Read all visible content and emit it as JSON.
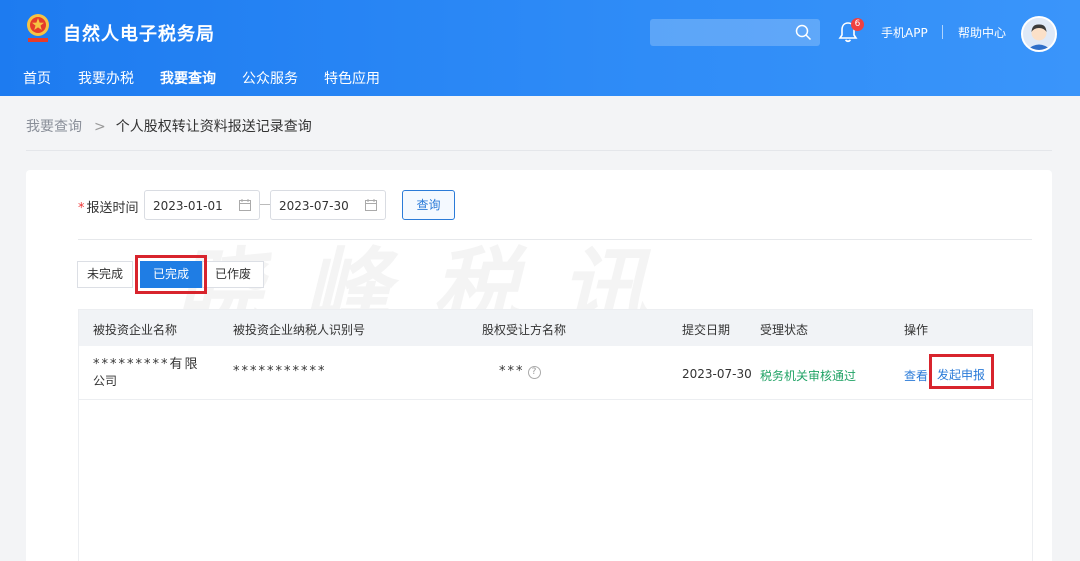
{
  "header": {
    "site_title": "自然人电子税务局",
    "logo_icon": "tax-emblem-icon",
    "bell_badge": "6",
    "links": {
      "app": "手机APP",
      "help": "帮助中心"
    }
  },
  "nav": {
    "items": [
      "首页",
      "我要办税",
      "我要查询",
      "公众服务",
      "特色应用"
    ],
    "active": "我要查询"
  },
  "breadcrumb": {
    "parent": "我要查询",
    "separator": ">",
    "current": "个人股权转让资料报送记录查询"
  },
  "watermark": "晓峰税讯",
  "form": {
    "label": "报送时间",
    "required_mark": "*",
    "start_date": "2023-01-01",
    "end_date": "2023-07-30",
    "query_button": "查询"
  },
  "tabs": [
    "未完成",
    "已完成",
    "已作废"
  ],
  "active_tab": "已完成",
  "table": {
    "headers": [
      "被投资企业名称",
      "被投资企业纳税人识别号",
      "股权受让方名称",
      "提交日期",
      "受理状态",
      "操作"
    ],
    "rows": [
      {
        "company_line1": "*********有限",
        "company_line2": "公司",
        "tax_id": "***********",
        "transferee": "***",
        "help_icon": "?",
        "date": "2023-07-30",
        "status": "税务机关审核通过",
        "actions": {
          "view": "查看",
          "declare": "发起申报"
        }
      }
    ]
  },
  "colors": {
    "header_blue": "#1d7bf0",
    "accent": "#1f7de4",
    "status_green": "#21a366",
    "highlight_red": "#d8242d"
  }
}
